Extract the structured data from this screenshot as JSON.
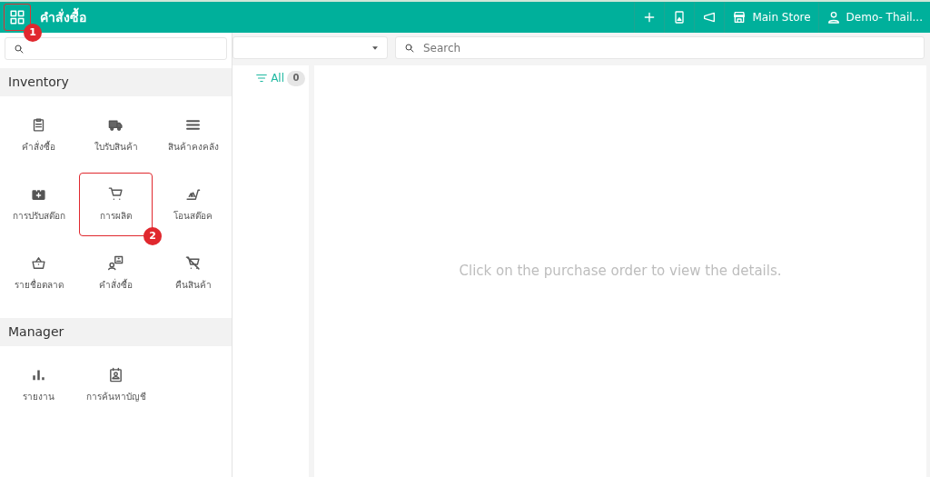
{
  "header": {
    "title": "คำสั่งซื้อ",
    "menu_annotation": "1",
    "actions": [
      {
        "kind": "plus"
      },
      {
        "kind": "device"
      },
      {
        "kind": "megaphone"
      },
      {
        "kind": "store",
        "label": "Main Store"
      },
      {
        "kind": "user",
        "label": "Demo- Thail..."
      }
    ]
  },
  "menu": {
    "sections": [
      {
        "title": "Inventory",
        "items": [
          {
            "label": "คำสั่งซื้อ",
            "highlighted": false
          },
          {
            "label": "ใบรับสินค้า",
            "highlighted": false
          },
          {
            "label": "สินค้าคงคลัง",
            "highlighted": false
          },
          {
            "label": "การปรับสต๊อก",
            "highlighted": false
          },
          {
            "label": "การผลิต",
            "highlighted": true,
            "annotation": "2"
          },
          {
            "label": "โอนสต๊อค",
            "highlighted": false
          },
          {
            "label": "รายชื่อตลาด",
            "highlighted": false
          },
          {
            "label": "คำสั่งซื้อ",
            "highlighted": false
          },
          {
            "label": "คืนสินค้า",
            "highlighted": false
          }
        ]
      },
      {
        "title": "Manager",
        "items": [
          {
            "label": "รายงาน",
            "highlighted": false
          },
          {
            "label": "การค้นหาบัญชี",
            "highlighted": false
          }
        ]
      }
    ]
  },
  "toolbar": {
    "search_placeholder": "Search"
  },
  "list": {
    "filter_label": "All",
    "count": "0"
  },
  "detail": {
    "message": "Click on the purchase order to view the details."
  }
}
